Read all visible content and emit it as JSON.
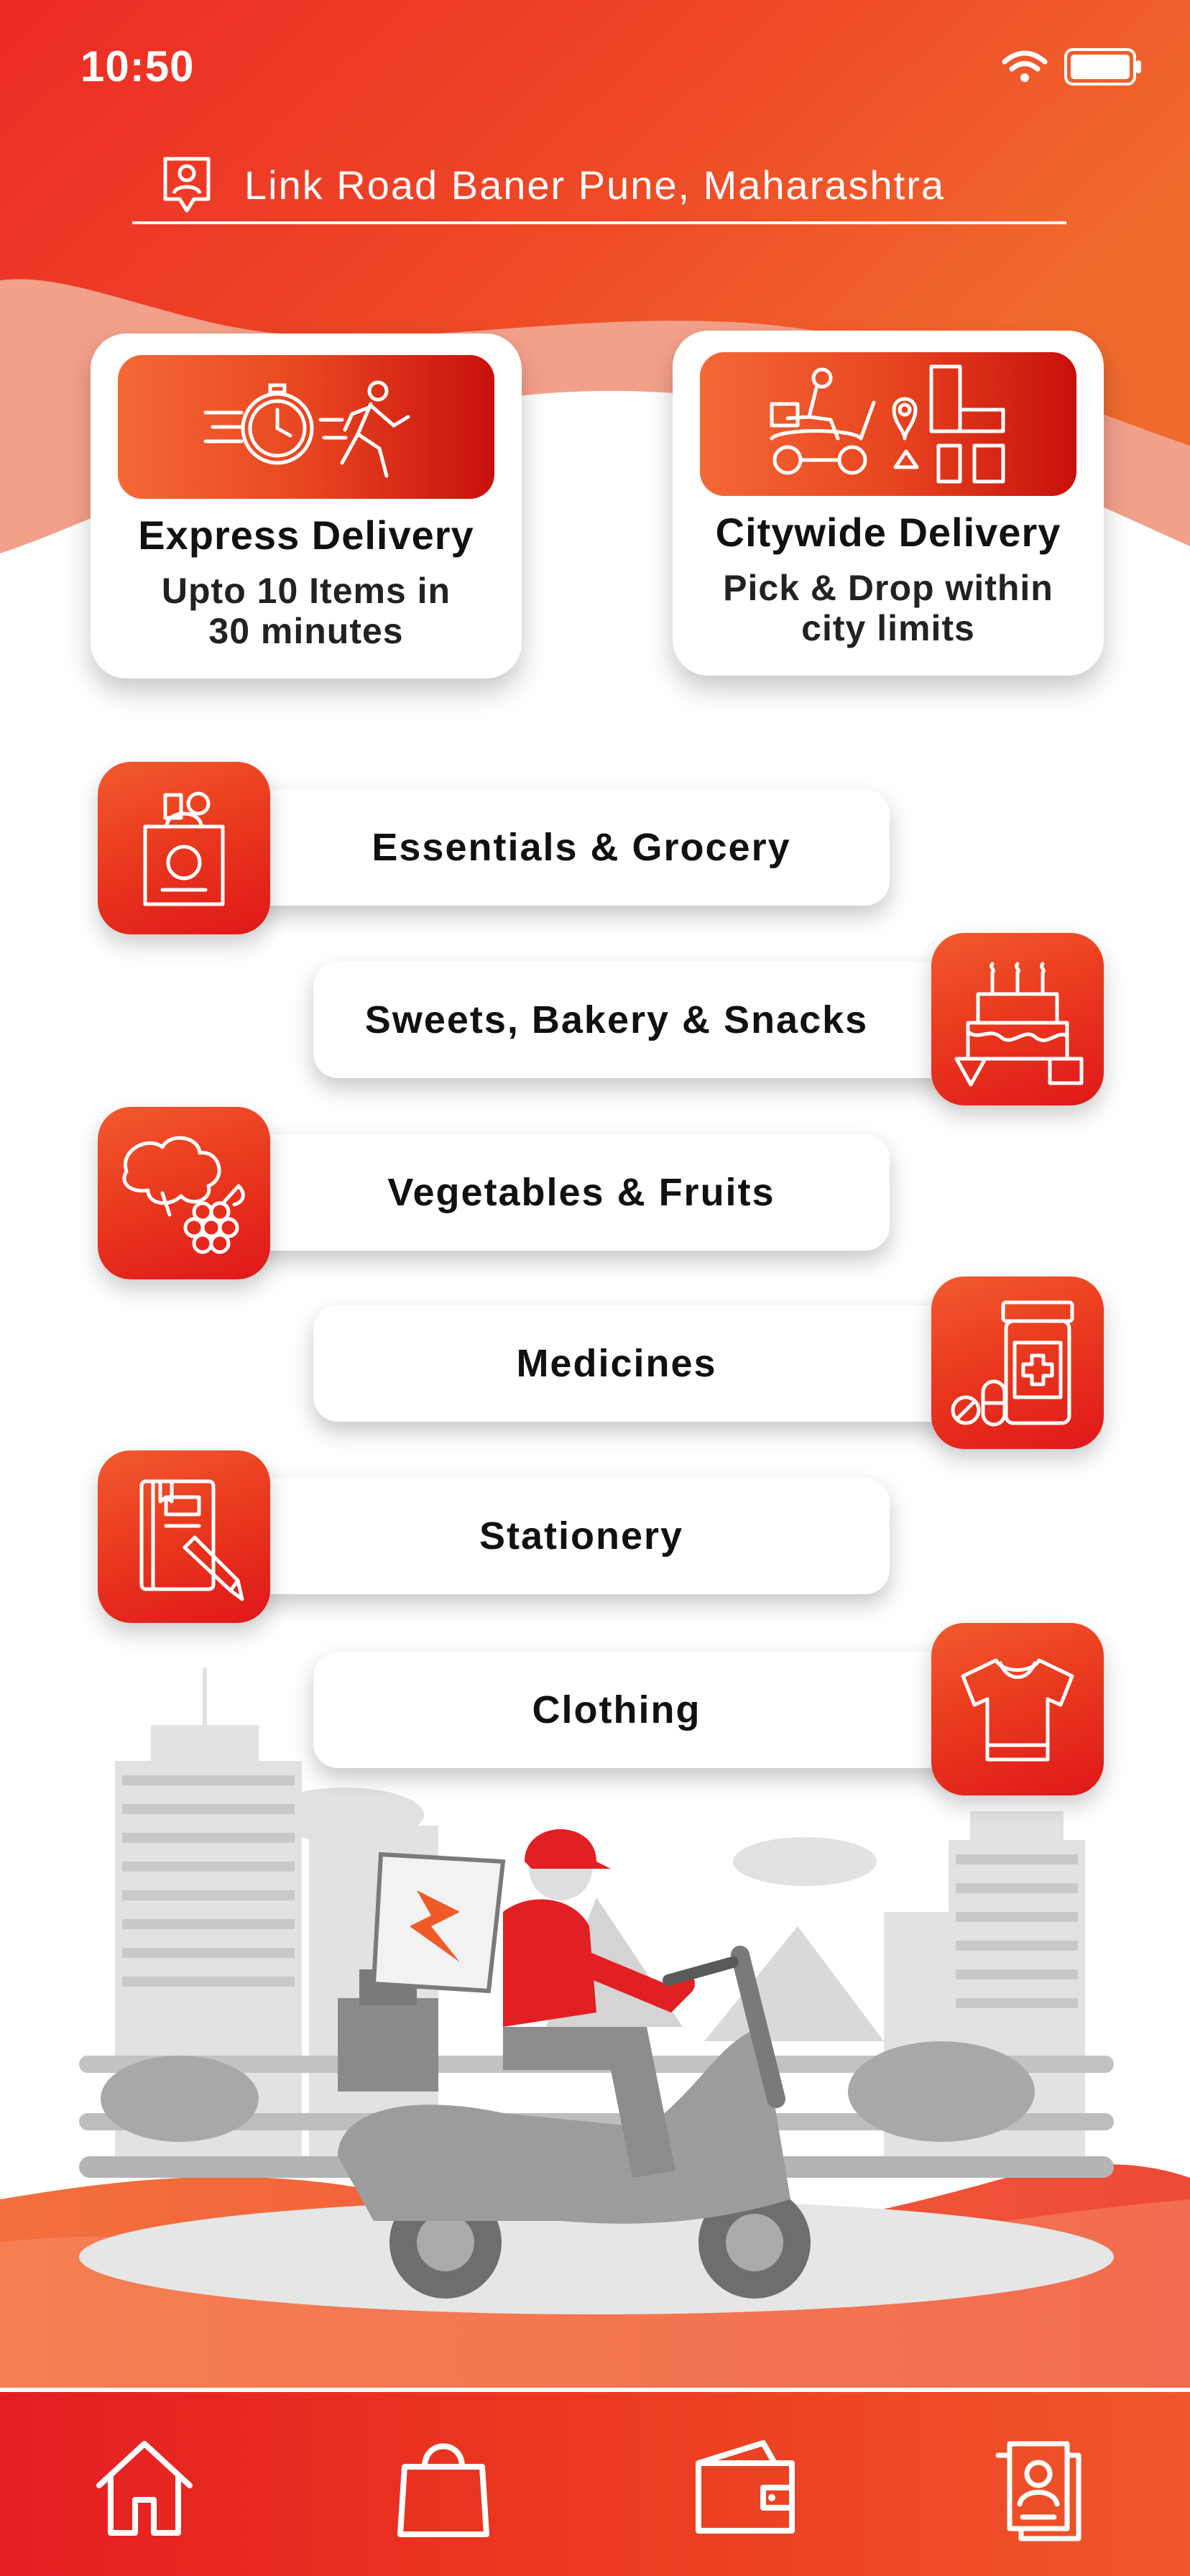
{
  "status_bar": {
    "time": "10:50",
    "wifi_icon": "wifi-icon",
    "battery_icon": "battery-icon"
  },
  "location": {
    "text": "Link Road Baner Pune, Maharashtra",
    "icon": "location-pin-icon"
  },
  "services": [
    {
      "title": "Express Delivery",
      "subtitle_line1": "Upto 10 Items in",
      "subtitle_line2": "30 minutes",
      "icon": "stopwatch-runner-icon"
    },
    {
      "title": "Citywide Delivery",
      "subtitle_line1": "Pick & Drop within",
      "subtitle_line2": "city limits",
      "icon": "scooter-city-map-icon"
    }
  ],
  "categories": [
    {
      "label": "Essentials & Grocery",
      "icon": "grocery-bag-icon"
    },
    {
      "label": "Sweets, Bakery & Snacks",
      "icon": "cake-icon"
    },
    {
      "label": "Vegetables & Fruits",
      "icon": "vegetables-fruits-icon"
    },
    {
      "label": "Medicines",
      "icon": "medicine-bottle-icon"
    },
    {
      "label": "Stationery",
      "icon": "book-pen-icon"
    },
    {
      "label": "Clothing",
      "icon": "t-shirt-icon"
    }
  ],
  "bottom_nav": [
    {
      "name": "home",
      "icon": "home-icon"
    },
    {
      "name": "orders",
      "icon": "shopping-bag-icon"
    },
    {
      "name": "wallet",
      "icon": "wallet-icon"
    },
    {
      "name": "profile",
      "icon": "profile-document-icon"
    }
  ],
  "colors": {
    "primary_red": "#e8231f",
    "primary_orange": "#f05a28",
    "white": "#ffffff"
  }
}
